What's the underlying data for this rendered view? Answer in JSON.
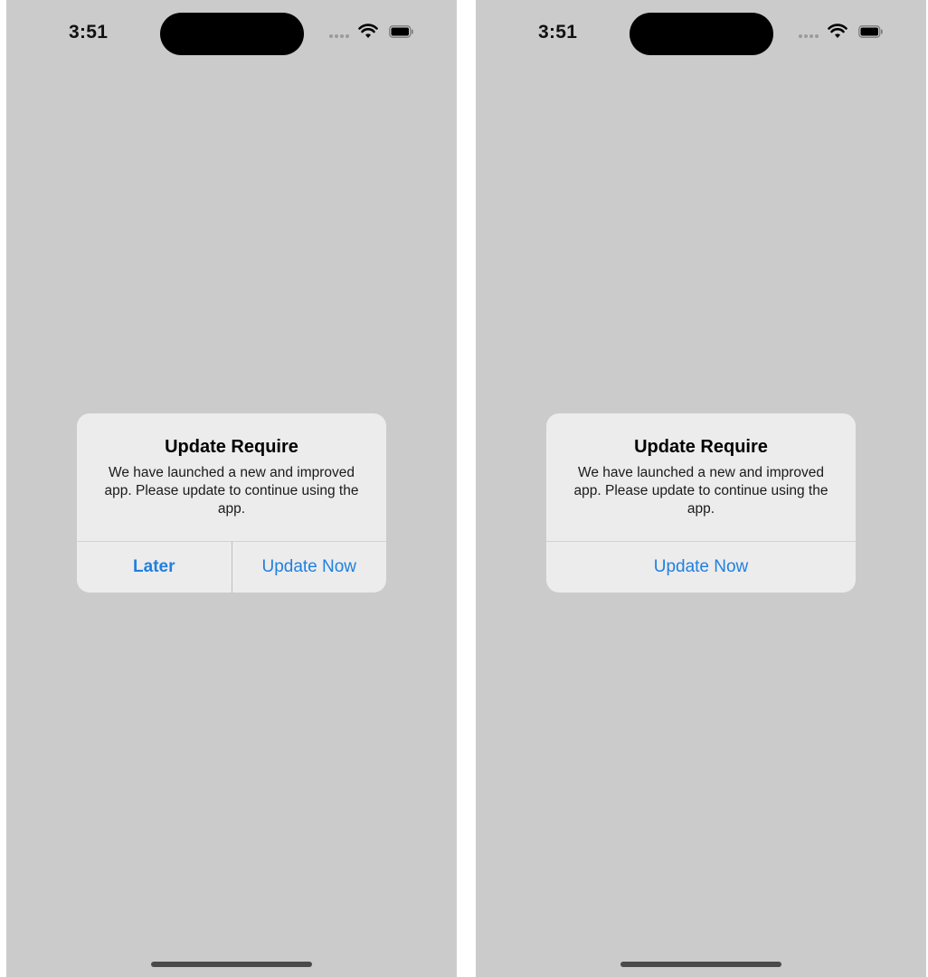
{
  "screens": [
    {
      "status_bar": {
        "time": "3:51"
      },
      "alert": {
        "title": "Update Require",
        "message": "We have launched a new and improved app. Please update to continue using the app.",
        "buttons": [
          {
            "label": "Later",
            "style": "bold"
          },
          {
            "label": "Update Now",
            "style": "regular"
          }
        ]
      }
    },
    {
      "status_bar": {
        "time": "3:51"
      },
      "alert": {
        "title": "Update Require",
        "message": "We have launched a new and improved app. Please update to continue using the app.",
        "buttons": [
          {
            "label": "Update Now",
            "style": "regular"
          }
        ]
      }
    }
  ],
  "colors": {
    "background": "#cbcbcb",
    "alert_bg": "#ececec",
    "accent": "#2080e0"
  }
}
